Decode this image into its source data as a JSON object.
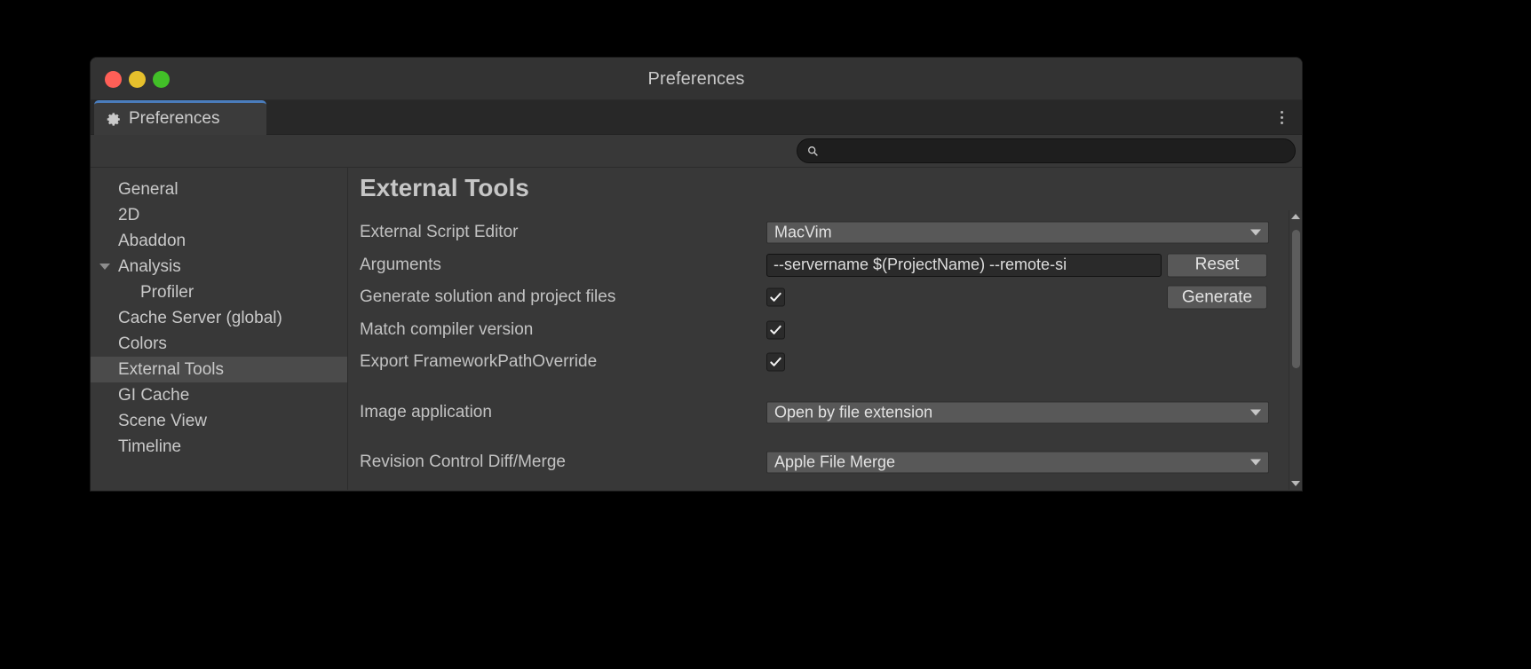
{
  "window": {
    "title": "Preferences",
    "traffic_lights": [
      {
        "name": "close",
        "color": "#ff5f57"
      },
      {
        "name": "minimize",
        "color": "#e6c02c"
      },
      {
        "name": "maximize",
        "color": "#42c028"
      }
    ]
  },
  "tabbar": {
    "tab_label": "Preferences",
    "tab_icon": "gear-icon",
    "accent_color": "#4a7dbd",
    "menu_icon": "kebab-menu-icon"
  },
  "search": {
    "icon": "search-icon",
    "value": "",
    "placeholder": ""
  },
  "sidebar": {
    "items": [
      {
        "label": "General",
        "selected": false,
        "child": false,
        "expander": false
      },
      {
        "label": "2D",
        "selected": false,
        "child": false,
        "expander": false
      },
      {
        "label": "Abaddon",
        "selected": false,
        "child": false,
        "expander": false
      },
      {
        "label": "Analysis",
        "selected": false,
        "child": false,
        "expander": true
      },
      {
        "label": "Profiler",
        "selected": false,
        "child": true,
        "expander": false
      },
      {
        "label": "Cache Server (global)",
        "selected": false,
        "child": false,
        "expander": false
      },
      {
        "label": "Colors",
        "selected": false,
        "child": false,
        "expander": false
      },
      {
        "label": "External Tools",
        "selected": true,
        "child": false,
        "expander": false
      },
      {
        "label": "GI Cache",
        "selected": false,
        "child": false,
        "expander": false
      },
      {
        "label": "Scene View",
        "selected": false,
        "child": false,
        "expander": false
      },
      {
        "label": "Timeline",
        "selected": false,
        "child": false,
        "expander": false
      }
    ]
  },
  "main": {
    "title": "External Tools",
    "rows": {
      "external_script_editor": {
        "label": "External Script Editor",
        "value": "MacVim"
      },
      "arguments": {
        "label": "Arguments",
        "value": "--servername $(ProjectName) --remote-si",
        "reset_button": "Reset"
      },
      "generate_solution": {
        "label": "Generate solution and project files",
        "checked": true,
        "generate_button": "Generate"
      },
      "match_compiler_version": {
        "label": "Match compiler version",
        "checked": true
      },
      "export_framework_path_override": {
        "label": "Export FrameworkPathOverride",
        "checked": true
      },
      "image_application": {
        "label": "Image application",
        "value": "Open by file extension"
      },
      "revision_control_diff_merge": {
        "label": "Revision Control Diff/Merge",
        "value": "Apple File Merge"
      }
    }
  },
  "scrollbar": {
    "up_icon": "chevron-up-icon",
    "down_icon": "chevron-down-icon"
  },
  "colors": {
    "window_bg": "#383838",
    "titlebar_bg": "#333333",
    "tabbar_bg": "#282828",
    "selection_bg": "#4b4b4b",
    "field_bg": "#585858",
    "text_field_bg": "#2a2a2a",
    "accent": "#4a7dbd"
  }
}
